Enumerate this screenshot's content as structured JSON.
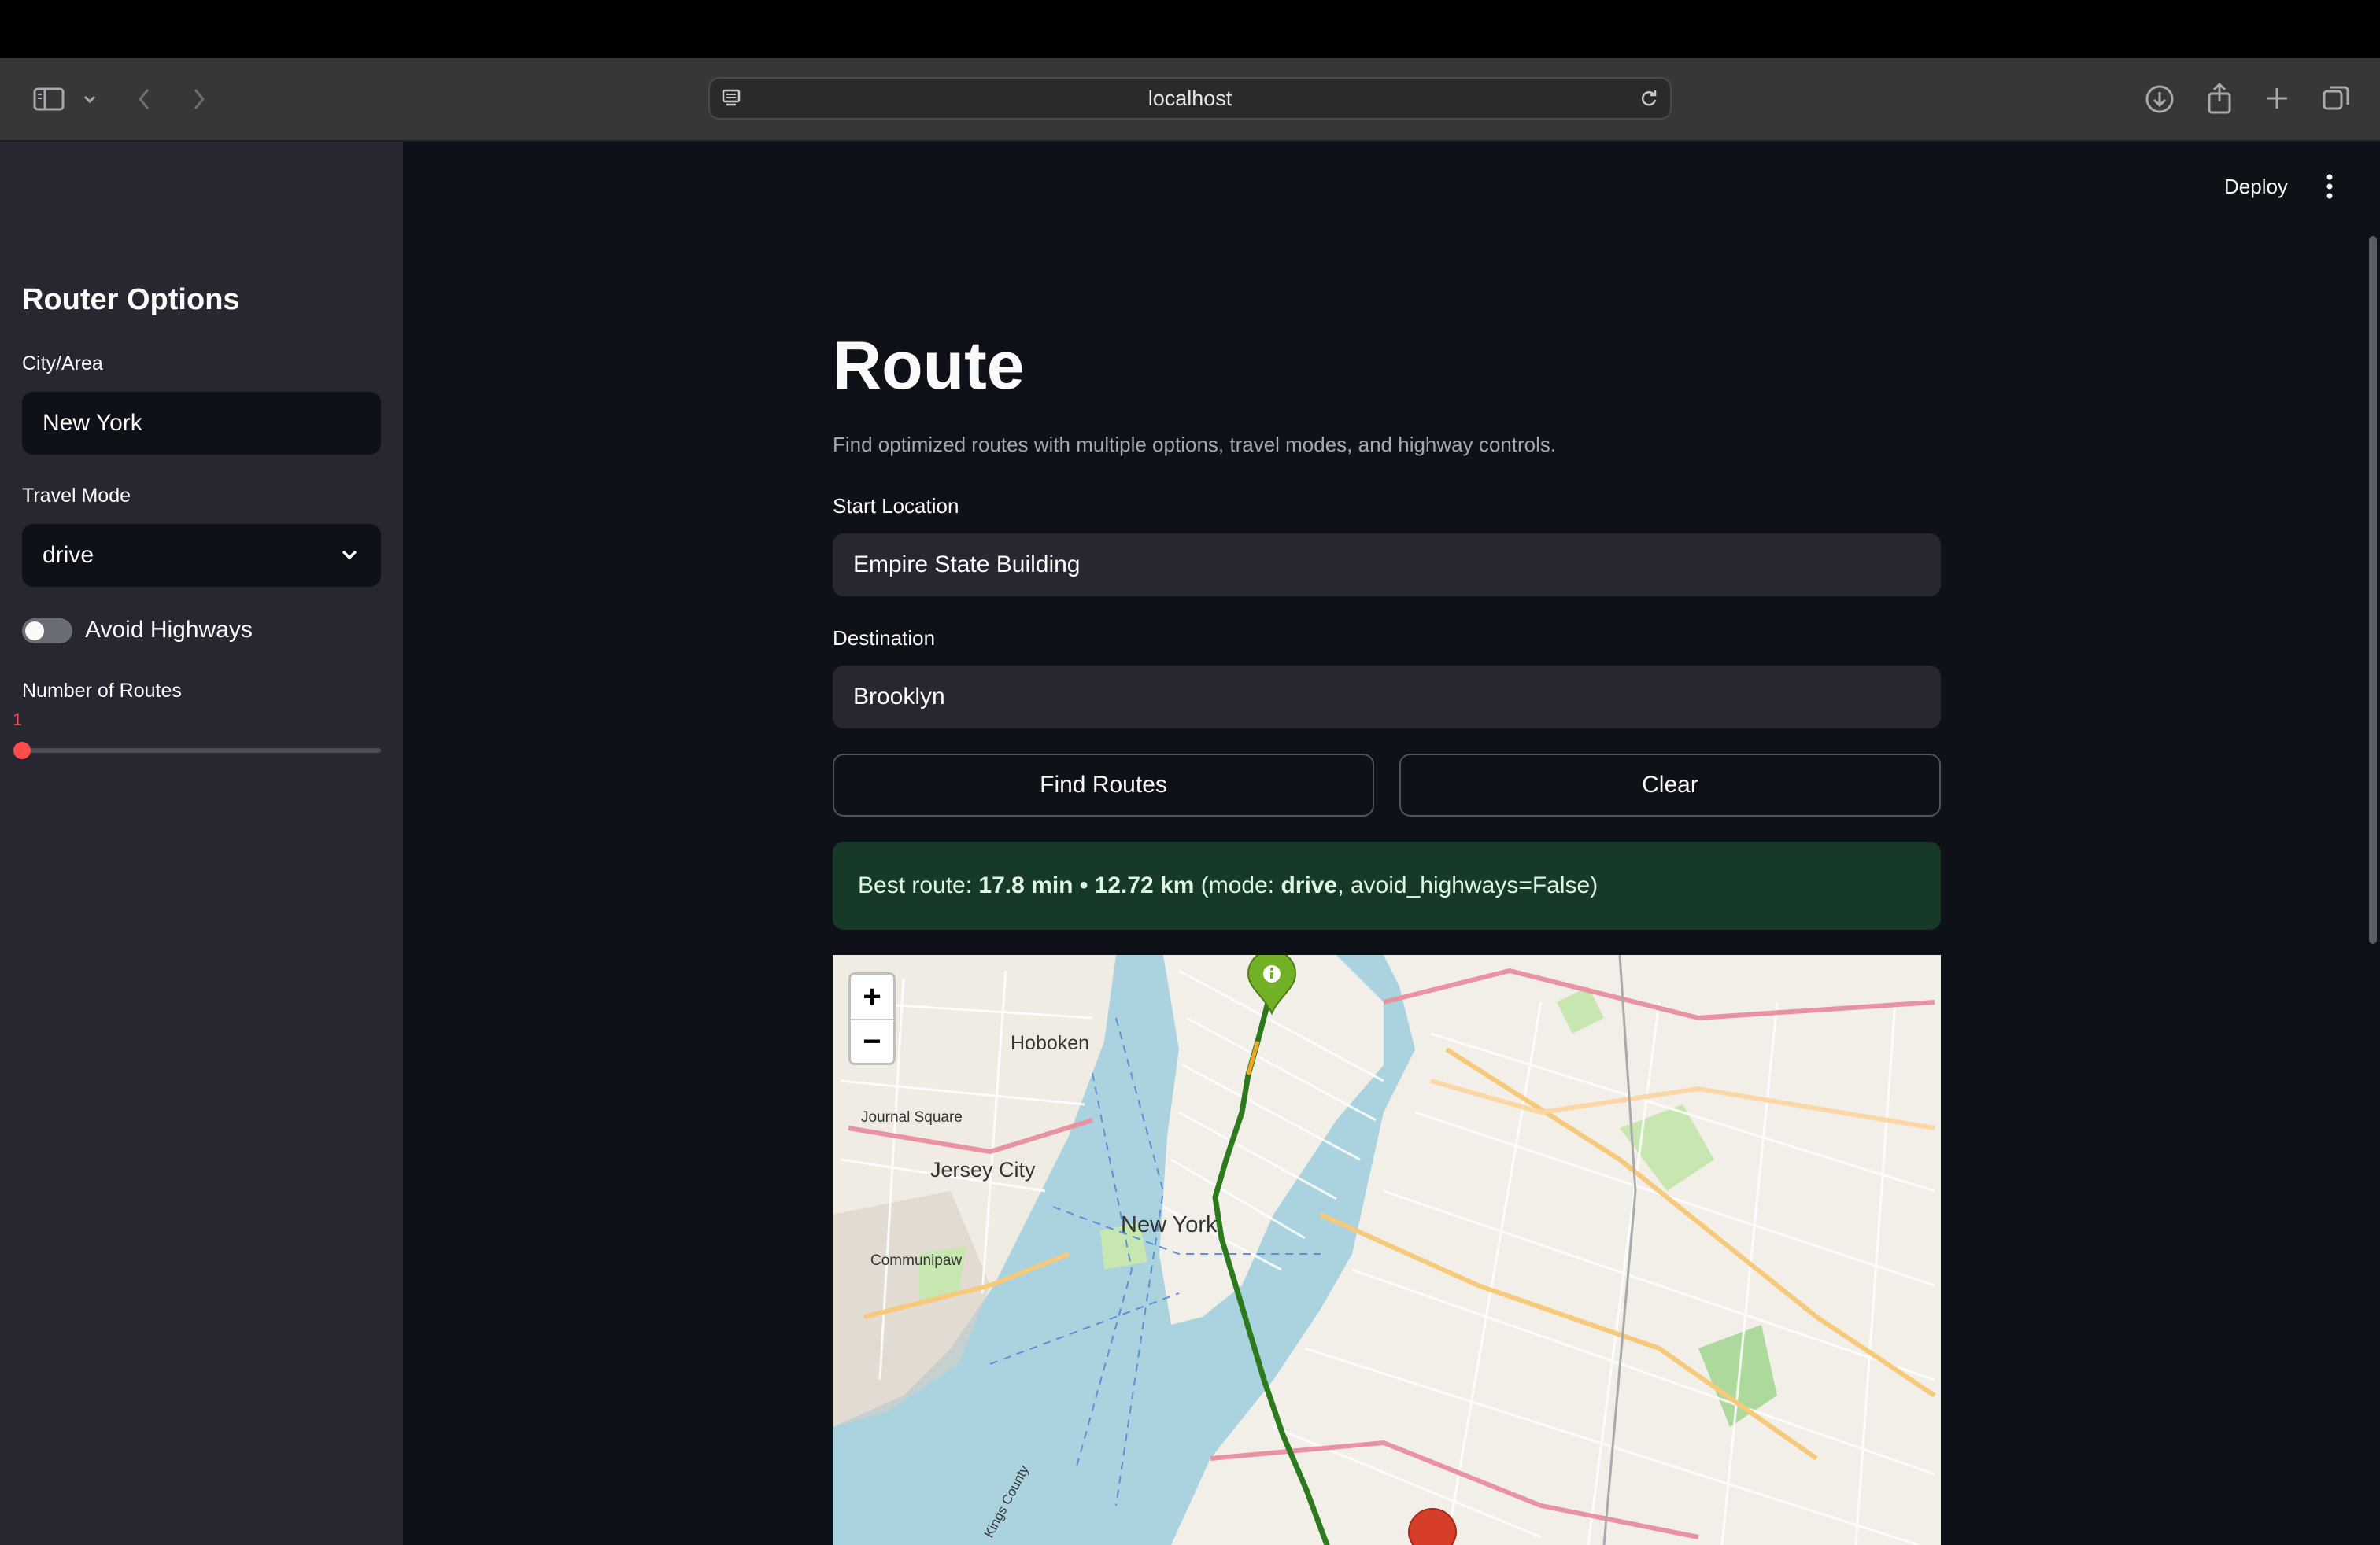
{
  "browser": {
    "address": "localhost"
  },
  "header": {
    "deploy_label": "Deploy"
  },
  "sidebar": {
    "title": "Router Options",
    "city_label": "City/Area",
    "city_value": "New York",
    "mode_label": "Travel Mode",
    "mode_value": "drive",
    "avoid_label": "Avoid Highways",
    "avoid_on": false,
    "routes_label": "Number of Routes",
    "routes_value": "1",
    "routes_fraction": 0.0
  },
  "main": {
    "title": "Route",
    "subtitle": "Find optimized routes with multiple options, travel modes, and highway controls.",
    "start_label": "Start Location",
    "start_value": "Empire State Building",
    "dest_label": "Destination",
    "dest_value": "Brooklyn",
    "find_button": "Find Routes",
    "clear_button": "Clear",
    "result": {
      "prefix": "Best route: ",
      "summary": "17.8 min • 12.72 km",
      "mode_prefix": " (mode: ",
      "mode": "drive",
      "suffix": ", avoid_highways=False)"
    }
  },
  "map": {
    "zoom_in": "+",
    "zoom_out": "−",
    "labels": {
      "hoboken": "Hoboken",
      "journal_square": "Journal Square",
      "jersey_city": "Jersey City",
      "new_york": "New York",
      "communipaw": "Communipaw",
      "kings_county": "Kings County"
    },
    "route_color": "#2d7a1e",
    "start_marker_color": "#72b026",
    "end_marker_color": "#d63e2a"
  },
  "colors": {
    "accent": "#ff4b4b",
    "success_bg": "#173928"
  }
}
